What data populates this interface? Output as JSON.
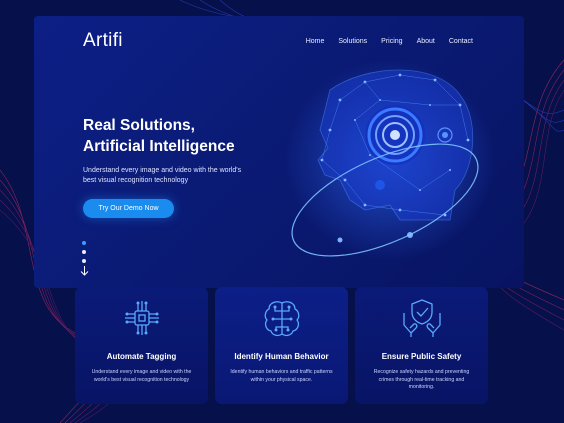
{
  "brand": {
    "logo_text": "Artifi"
  },
  "nav": {
    "items": [
      "Home",
      "Solutions",
      "Pricing",
      "About",
      "Contact"
    ]
  },
  "hero": {
    "title_line1": "Real Solutions,",
    "title_line2": "Artificial Intelligence",
    "subtitle": "Understand every image and video with the world's best visual recognition technology",
    "cta_label": "Try Our Demo Now"
  },
  "pager": {
    "count": 3,
    "active_index": 0
  },
  "features": [
    {
      "icon": "circuit-chip-icon",
      "title": "Automate Tagging",
      "desc": "Understand every image and video with the world's best visual recognition technology"
    },
    {
      "icon": "brain-circuit-icon",
      "title": "Identify Human Behavior",
      "desc": "Identify human behaviors and traffic patterns within your physical space."
    },
    {
      "icon": "shield-hands-icon",
      "title": "Ensure Public Safety",
      "desc": "Recognize safety hazards and preventing crimes through real-time tracking and monitoring."
    }
  ],
  "colors": {
    "background": "#06104a",
    "panel": "#0c1f86",
    "accent": "#1a8cf0",
    "wave": "#ff3a6a"
  }
}
